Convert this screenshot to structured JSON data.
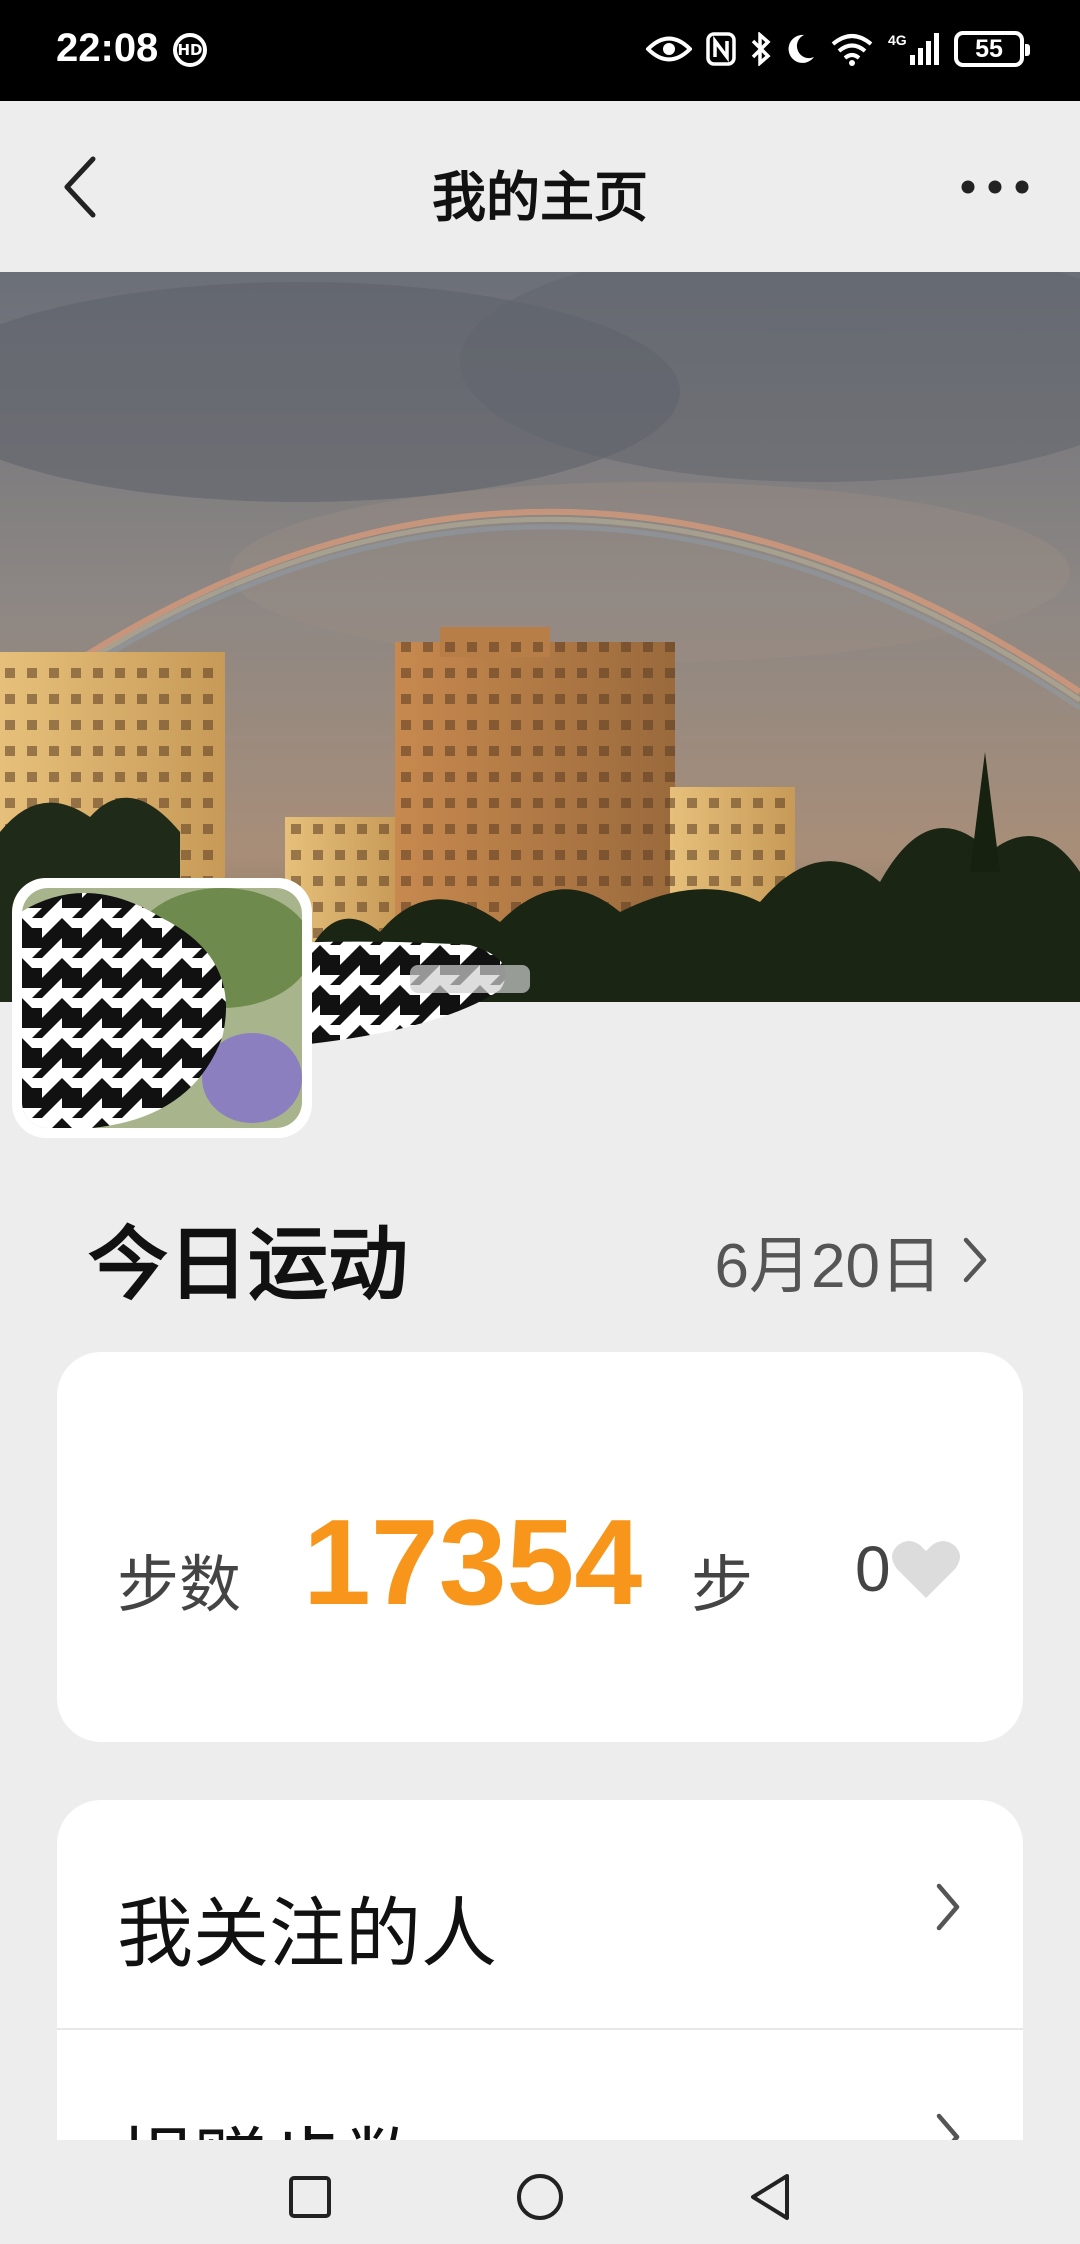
{
  "status_bar": {
    "time": "22:08",
    "hd_badge": "HD",
    "network": "4G",
    "battery": "55",
    "icons": [
      "eye-icon",
      "nfc-icon",
      "bluetooth-icon",
      "moon-icon",
      "wifi-icon",
      "signal-icon",
      "battery-icon"
    ]
  },
  "header": {
    "title": "我的主页",
    "back_icon": "chevron-left-icon",
    "more_icon": "more-horizontal-icon"
  },
  "today": {
    "title": "今日运动",
    "date": "6月20日"
  },
  "steps_card": {
    "label": "步数",
    "value": "17354",
    "unit": "步",
    "likes": "0"
  },
  "list": {
    "items": [
      {
        "label": "我关注的人"
      },
      {
        "label": "捐赠步数"
      }
    ]
  },
  "colors": {
    "accent": "#f7961b",
    "background": "#ededed",
    "card": "#ffffff"
  }
}
